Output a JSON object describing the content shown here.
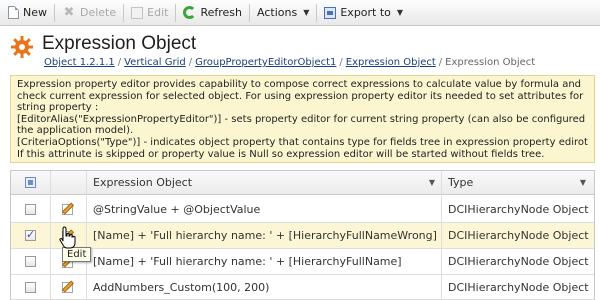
{
  "toolbar": {
    "new": "New",
    "delete": "Delete",
    "edit": "Edit",
    "refresh": "Refresh",
    "actions": "Actions",
    "export": "Export to"
  },
  "page": {
    "title": "Expression Object",
    "breadcrumb": [
      "Object 1.2.1.1",
      "Vertical Grid",
      "GroupPropertyEditorObject1",
      "Expression Object",
      "Expression Object"
    ]
  },
  "info": {
    "lines": [
      "Expression property editor provides capability to compose correct expressions to calculate value by formula and",
      "check current expression for selected object. For using expression property editor its needed to set attributes for",
      "string property :",
      "[EditorAlias(\"ExpressionPropertyEditor\")] - sets property editor for current string property (can also be configured by",
      "the application model).",
      "[CriteriaOptions(\"Type\")] - indicates object property that contains type for fields tree in expression property edirot.",
      "If this attrinute is skipped or property value is Null so expression editor will be started without fields tree."
    ]
  },
  "grid": {
    "columns": [
      "Expression Object",
      "Type"
    ],
    "rows": [
      {
        "expression": "@StringValue + @ObjectValue",
        "type": "DCIHierarchyNode Object",
        "checked": false
      },
      {
        "expression": "[Name] + 'Full hierarchy name: ' + [HierarchyFullNameWrong]",
        "type": "DCIHierarchyNode Object",
        "checked": true
      },
      {
        "expression": "[Name] + 'Full hierarchy name: ' + [HierarchyFullName]",
        "type": "DCIHierarchyNode Object",
        "checked": false
      },
      {
        "expression": "AddNumbers_Custom(100, 200)",
        "type": "DCIHierarchyNode Object",
        "checked": false
      }
    ]
  },
  "tooltip": "Edit",
  "icons": {
    "new": "new-document-icon",
    "delete": "delete-x-icon",
    "edit": "edit-icon",
    "refresh": "refresh-icon",
    "export": "export-icon",
    "header": "gear-icon",
    "row": "edit-pencil-icon"
  },
  "colors": {
    "info_bg": "#fbf6cf",
    "selected_row_bg": "#fdf6d6",
    "link": "#1c3f7d",
    "gear": "#e8741e"
  }
}
